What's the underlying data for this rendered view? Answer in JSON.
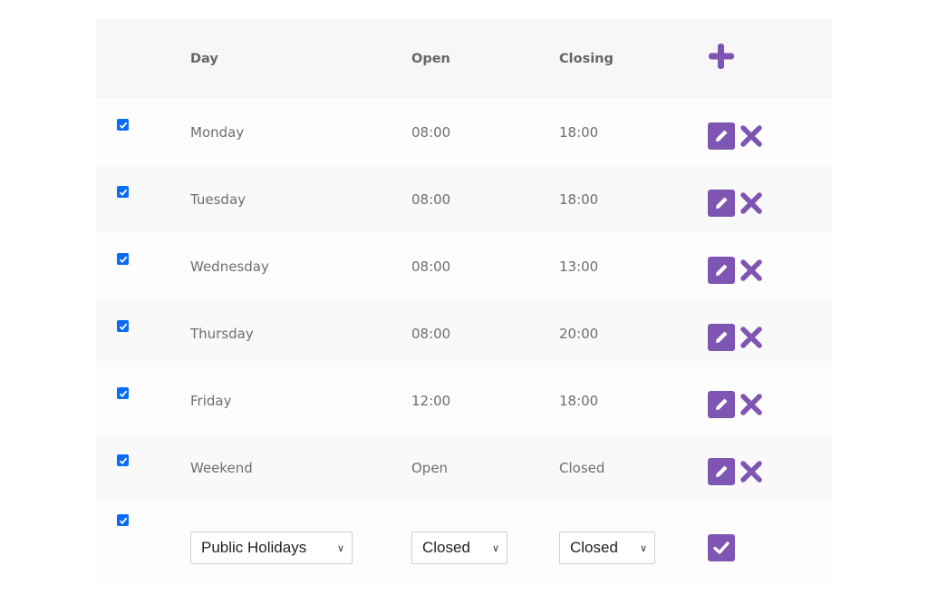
{
  "header": {
    "columns": [
      "Day",
      "Open",
      "Closing"
    ],
    "add_icon": "plus-icon"
  },
  "colors": {
    "accent": "#7f55b4",
    "checkbox": "#0a6cf5"
  },
  "rows": [
    {
      "day": "Monday",
      "open": "08:00",
      "closing": "18:00",
      "checked": true
    },
    {
      "day": "Tuesday",
      "open": "08:00",
      "closing": "18:00",
      "checked": true
    },
    {
      "day": "Wednesday",
      "open": "08:00",
      "closing": "13:00",
      "checked": true
    },
    {
      "day": "Thursday",
      "open": "08:00",
      "closing": "20:00",
      "checked": true
    },
    {
      "day": "Friday",
      "open": "12:00",
      "closing": "18:00",
      "checked": true
    },
    {
      "day": "Weekend",
      "open": "Open",
      "closing": "Closed",
      "checked": true
    }
  ],
  "new_row": {
    "checked": true,
    "day_select": "Public Holidays",
    "open_select": "Closed",
    "closing_select": "Closed",
    "confirm_icon": "check-icon"
  }
}
